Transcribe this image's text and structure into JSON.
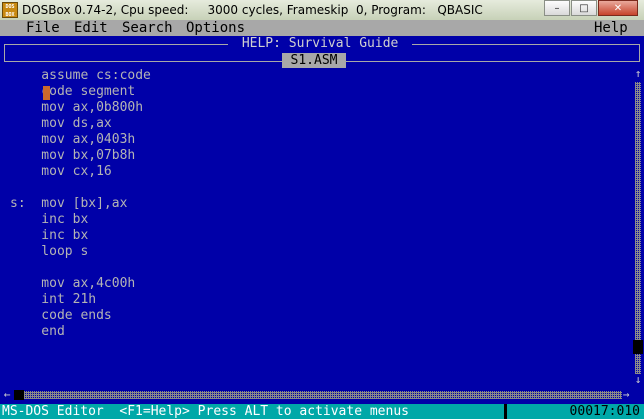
{
  "window": {
    "title": "DOSBox 0.74-2, Cpu speed:     3000 cycles, Frameskip  0, Program:   QBASIC",
    "icon_text": "DOS BOX",
    "buttons": {
      "minimize": "–",
      "maximize": "□",
      "close": "✕"
    }
  },
  "menu": {
    "items": [
      "File",
      "Edit",
      "Search",
      "Options"
    ],
    "help": "Help"
  },
  "help_window": {
    "title": " HELP: Survival Guide ",
    "file_tab": "S1.ASM"
  },
  "code": {
    "lines": [
      "    assume cs:code",
      "    code segment",
      "    mov ax,0b800h",
      "    mov ds,ax",
      "    mov ax,0403h",
      "    mov bx,07b8h",
      "    mov cx,16",
      "",
      "s:  mov [bx],ax",
      "    inc bx",
      "    inc bx",
      "    loop s",
      "",
      "    mov ax,4c00h",
      "    int 21h",
      "    code ends",
      "    end"
    ]
  },
  "scrollbar": {
    "up": "↑",
    "down": "↓",
    "left": "←",
    "right": "→"
  },
  "status": {
    "message": "MS-DOS Editor  <F1=Help> Press ALT to activate menus",
    "position": "00017:010"
  },
  "colors": {
    "background": "#0000a8",
    "text": "#b4b4b4",
    "menu": "#a8a8a8",
    "status": "#00a8a8",
    "cursor": "#c9692d"
  }
}
